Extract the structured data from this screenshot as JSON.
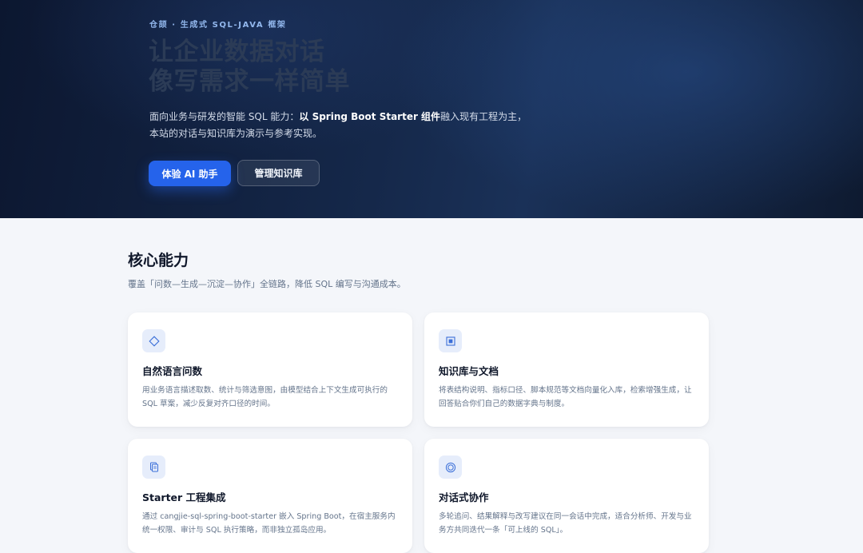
{
  "hero": {
    "eyebrow": "仓颉 · 生成式 SQL-JAVA 框架",
    "headline_line1": "让企业数据对话",
    "headline_line2": "像写需求一样简单",
    "desc_part1": "面向业务与研发的智能 SQL 能力：",
    "desc_bold1": "以 Spring Boot Starter 组件",
    "desc_part2": "融入现有工程为主，本站的对话与知识库为演示与参考实现。",
    "primary_button": "体验 AI 助手",
    "secondary_button": "管理知识库"
  },
  "capabilities": {
    "title": "核心能力",
    "subtitle": "覆盖「问数—生成—沉淀—协作」全链路，降低 SQL 编写与沟通成本。",
    "cards": [
      {
        "icon": "diamond-icon",
        "title": "自然语言问数",
        "desc": "用业务语言描述取数、统计与筛选意图，由模型结合上下文生成可执行的 SQL 草案，减少反复对齐口径的时间。"
      },
      {
        "icon": "square-dot-icon",
        "title": "知识库与文档",
        "desc": "将表结构说明、指标口径、脚本规范等文档向量化入库，检索增强生成，让回答贴合你们自己的数据字典与制度。"
      },
      {
        "icon": "document-icon",
        "title": "Starter 工程集成",
        "desc": "通过 cangjie-sql-spring-boot-starter 嵌入 Spring Boot，在宿主服务内统一权限、审计与 SQL 执行策略，而非独立孤岛应用。"
      },
      {
        "icon": "concentric-circle-icon",
        "title": "对话式协作",
        "desc": "多轮追问、结果解释与改写建议在同一会话中完成，适合分析师、开发与业务方共同迭代一条「可上线的 SQL」。"
      }
    ]
  },
  "colors": {
    "accent": "#2563eb",
    "hero_bg": "#13264a",
    "page_bg": "#f4f6fa"
  }
}
